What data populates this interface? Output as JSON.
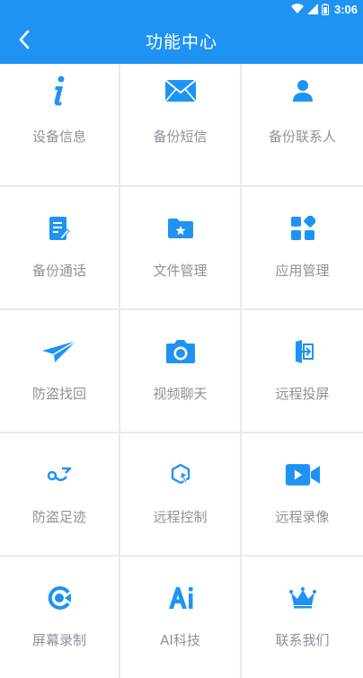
{
  "status_bar": {
    "time": "3:06",
    "icons": [
      "wifi-icon",
      "signal-icon",
      "battery-icon"
    ]
  },
  "app_bar": {
    "title": "功能中心",
    "back_icon": "chevron-left-icon"
  },
  "colors": {
    "primary": "#1f93f3",
    "label_gray": "#8c9299",
    "divider": "#e7ebef"
  },
  "features": [
    {
      "label": "设备信息",
      "icon": "info-icon"
    },
    {
      "label": "备份短信",
      "icon": "envelope-icon"
    },
    {
      "label": "备份联系人",
      "icon": "person-icon"
    },
    {
      "label": "备份通话",
      "icon": "call-log-icon"
    },
    {
      "label": "文件管理",
      "icon": "folder-star-icon"
    },
    {
      "label": "应用管理",
      "icon": "apps-icon"
    },
    {
      "label": "防盗找回",
      "icon": "paper-plane-icon"
    },
    {
      "label": "视频聊天",
      "icon": "camera-icon"
    },
    {
      "label": "远程投屏",
      "icon": "cast-screen-icon"
    },
    {
      "label": "防盗足迹",
      "icon": "route-icon"
    },
    {
      "label": "远程控制",
      "icon": "remote-control-icon"
    },
    {
      "label": "远程录像",
      "icon": "video-camera-icon"
    },
    {
      "label": "屏幕录制",
      "icon": "screen-record-icon"
    },
    {
      "label": "AI科技",
      "icon": "ai-icon"
    },
    {
      "label": "联系我们",
      "icon": "crown-icon"
    }
  ]
}
